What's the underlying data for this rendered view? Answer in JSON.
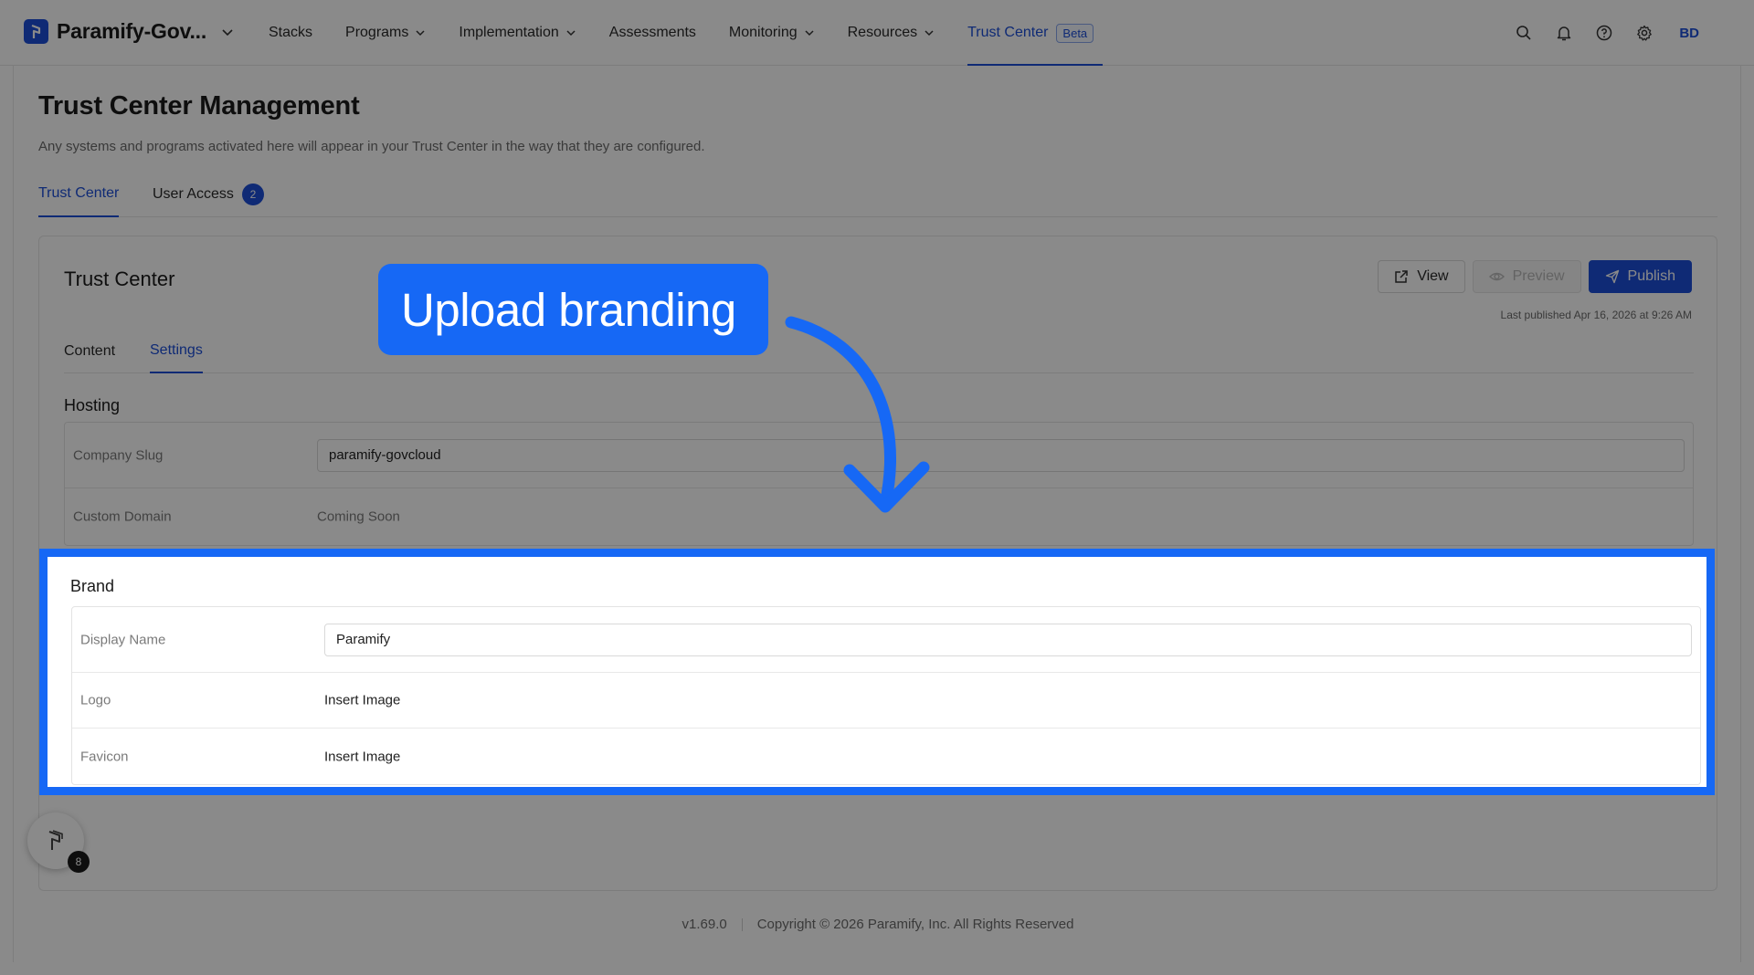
{
  "app": {
    "workspace": "Paramify-Gov...",
    "avatar_initials": "BD"
  },
  "nav": {
    "items": [
      {
        "label": "Stacks",
        "dropdown": false
      },
      {
        "label": "Programs",
        "dropdown": true
      },
      {
        "label": "Implementation",
        "dropdown": true
      },
      {
        "label": "Assessments",
        "dropdown": false
      },
      {
        "label": "Monitoring",
        "dropdown": true
      },
      {
        "label": "Resources",
        "dropdown": true
      },
      {
        "label": "Trust Center",
        "dropdown": false,
        "active": true,
        "badge": "Beta"
      }
    ],
    "icons": [
      "search-icon",
      "bell-icon",
      "help-icon",
      "gear-icon"
    ]
  },
  "page": {
    "title": "Trust Center Management",
    "subtitle": "Any systems and programs activated here will appear in your Trust Center in the way that they are configured.",
    "tabs": [
      {
        "label": "Trust Center",
        "active": true
      },
      {
        "label": "User Access",
        "count": "2"
      }
    ]
  },
  "card": {
    "title": "Trust Center",
    "buttons": {
      "view": "View",
      "preview": "Preview",
      "publish": "Publish"
    },
    "last_published": "Last published Apr 16, 2026 at 9:26 AM",
    "tabs": [
      {
        "label": "Content"
      },
      {
        "label": "Settings",
        "active": true
      }
    ]
  },
  "hosting": {
    "title": "Hosting",
    "company_slug_label": "Company Slug",
    "company_slug_value": "paramify-govcloud",
    "custom_domain_label": "Custom Domain",
    "custom_domain_value": "Coming Soon"
  },
  "brand": {
    "title": "Brand",
    "display_name_label": "Display Name",
    "display_name_value": "Paramify",
    "logo_label": "Logo",
    "logo_value": "Insert Image",
    "favicon_label": "Favicon",
    "favicon_value": "Insert Image"
  },
  "footer": {
    "version": "v1.69.0",
    "copyright": "Copyright © 2026 Paramify, Inc. All Rights Reserved"
  },
  "help_widget": {
    "count": "8"
  },
  "callout": {
    "text": "Upload branding"
  },
  "colors": {
    "accent": "#1c4fd8",
    "highlight": "#1668f5"
  }
}
